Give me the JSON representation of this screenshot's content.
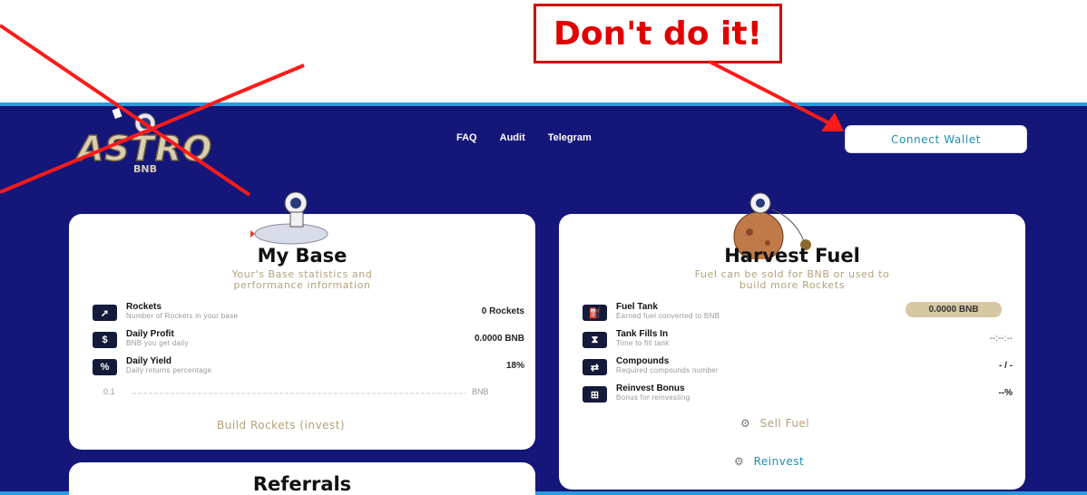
{
  "annotation": {
    "text": "Don't do it!"
  },
  "header": {
    "logo_text": "ASTRO",
    "logo_sub": "BNB",
    "nav": [
      "FAQ",
      "Audit",
      "Telegram"
    ],
    "connect_label": "Connect Wallet"
  },
  "base": {
    "title": "My Base",
    "subtitle_1": "Your's Base statistics and",
    "subtitle_2": "performance information",
    "rows": [
      {
        "label": "Rockets",
        "desc": "Number of Rockets in your base",
        "value": "0 Rockets",
        "icon": "rocket-icon"
      },
      {
        "label": "Daily Profit",
        "desc": "BNB you get daily",
        "value": "0.0000 BNB",
        "icon": "money-bag-icon"
      },
      {
        "label": "Daily Yield",
        "desc": "Daily returns percentage",
        "value": "18%",
        "icon": "percent-icon"
      }
    ],
    "slider": {
      "min": "0.1",
      "unit": "BNB"
    },
    "build_label": "Build Rockets (invest)"
  },
  "fuel": {
    "title": "Harvest Fuel",
    "subtitle_1": "Fuel can be sold for BNB or used to",
    "subtitle_2": "build more Rockets",
    "rows": [
      {
        "label": "Fuel Tank",
        "desc": "Earned fuel converted to BNB",
        "value": "0.0000 BNB",
        "icon": "fuel-pump-icon"
      },
      {
        "label": "Tank Fills In",
        "desc": "Time to fill tank",
        "value": "--:--:--",
        "icon": "hourglass-icon"
      },
      {
        "label": "Compounds",
        "desc": "Required compounds number",
        "value": "- / -",
        "icon": "compound-icon"
      },
      {
        "label": "Reinvest Bonus",
        "desc": "Bonus for reinvesting",
        "value": "--%",
        "icon": "gift-icon"
      }
    ],
    "sell_label": "Sell Fuel",
    "reinvest_label": "Reinvest"
  },
  "referrals": {
    "title": "Referrals"
  },
  "colors": {
    "annotation_red": "#e00000",
    "background_navy": "#141679",
    "accent_teal": "#1e8fb0",
    "gold": "#b5a27a"
  }
}
